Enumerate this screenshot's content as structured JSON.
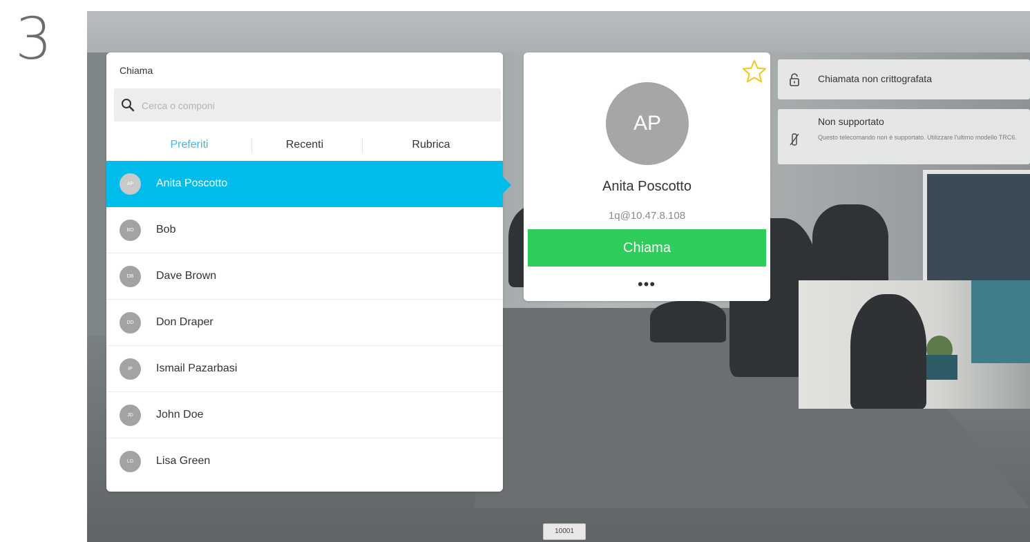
{
  "step_number": "3",
  "call_panel": {
    "title": "Chiama",
    "search_placeholder": "Cerca o componi",
    "tabs": [
      {
        "label": "Preferiti",
        "active": true
      },
      {
        "label": "Recenti",
        "active": false
      },
      {
        "label": "Rubrica",
        "active": false
      }
    ],
    "contacts": [
      {
        "initials": "AP",
        "name": "Anita Poscotto",
        "selected": true
      },
      {
        "initials": "BO",
        "name": "Bob",
        "selected": false
      },
      {
        "initials": "DB",
        "name": "Dave Brown",
        "selected": false
      },
      {
        "initials": "DD",
        "name": "Don Draper",
        "selected": false
      },
      {
        "initials": "IP",
        "name": "Ismail Pazarbasi",
        "selected": false
      },
      {
        "initials": "JD",
        "name": "John Doe",
        "selected": false
      },
      {
        "initials": "LG",
        "name": "Lisa Green",
        "selected": false
      }
    ]
  },
  "contact_card": {
    "initials": "AP",
    "name": "Anita Poscotto",
    "address": "1q@10.47.8.108",
    "call_label": "Chiama",
    "more_label": "•••",
    "favorite_icon": "star-icon"
  },
  "notifications": [
    {
      "icon": "lock-icon",
      "title": "Chiamata non crittografata",
      "body": ""
    },
    {
      "icon": "no-remote-icon",
      "title": "Non supportato",
      "body": "Questo telecomando non è supportato. Utilizzare l'ultimo modello TRC6."
    }
  ],
  "call_id": "10001",
  "colors": {
    "accent_blue": "#00bceb",
    "tab_active": "#3cb8e6",
    "call_green": "#2ecc5b",
    "favorite_star": "#f5c518"
  }
}
